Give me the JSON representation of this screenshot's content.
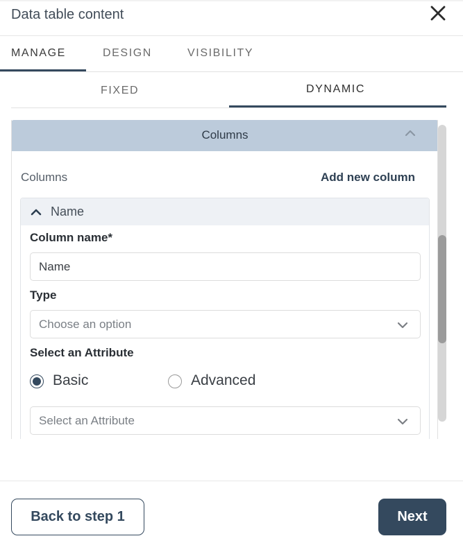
{
  "header": {
    "title": "Data table content",
    "close_icon": "close-x-icon"
  },
  "main_tabs": [
    {
      "label": "MANAGE",
      "active": true
    },
    {
      "label": "DESIGN",
      "active": false
    },
    {
      "label": "VISIBILITY",
      "active": false
    }
  ],
  "sub_tabs": [
    {
      "label": "FIXED",
      "active": false
    },
    {
      "label": "DYNAMIC",
      "active": true
    }
  ],
  "columns_section": {
    "header_label": "Columns",
    "header_icon": "chevron-up-icon",
    "expanded": true,
    "list_label": "Columns",
    "add_column_label": "Add new column",
    "items": [
      {
        "title": "Name",
        "expanded": true,
        "column_name_label": "Column name*",
        "column_name_value": "Name",
        "type_label": "Type",
        "type_placeholder": "Choose an option",
        "attribute_label": "Select an Attribute",
        "attribute_modes": [
          {
            "label": "Basic",
            "checked": true
          },
          {
            "label": "Advanced",
            "checked": false
          }
        ],
        "attribute_placeholder": "Select an Attribute"
      }
    ]
  },
  "footer": {
    "back_label": "Back to step 1",
    "next_label": "Next"
  },
  "colors": {
    "primary": "#34495e",
    "section_header_bg": "#bccbdb",
    "item_header_bg": "#eef1f5"
  }
}
